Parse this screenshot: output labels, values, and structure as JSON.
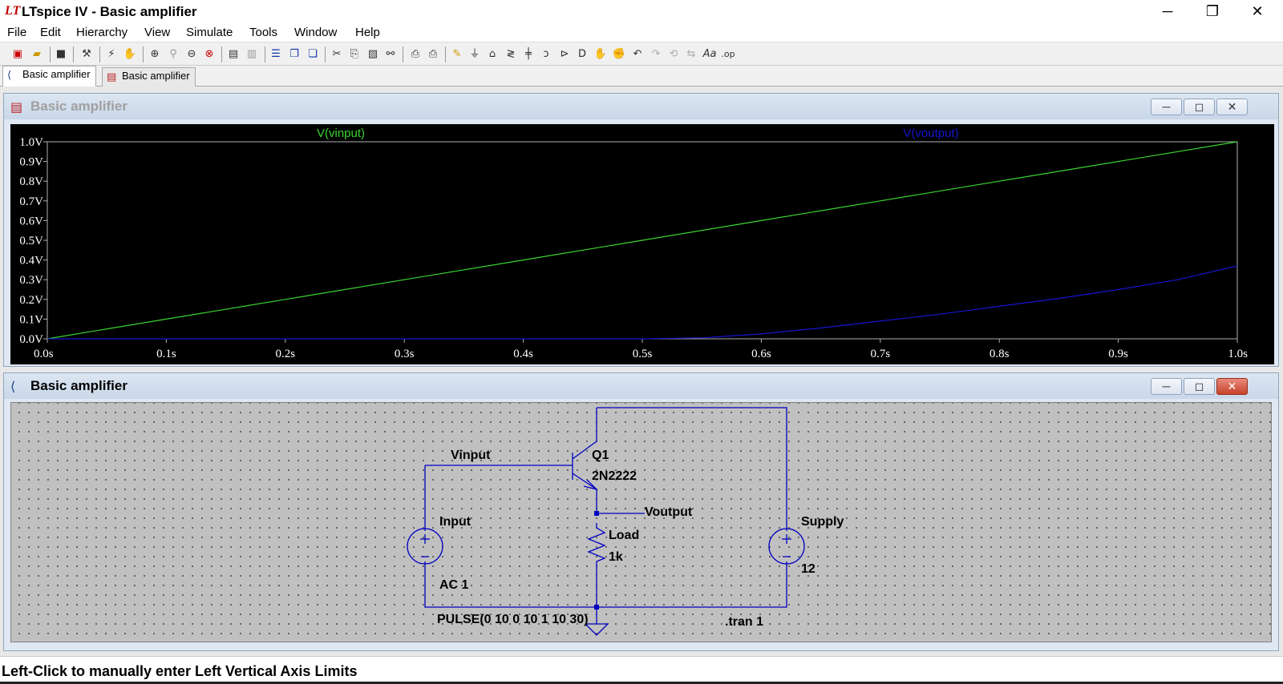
{
  "window": {
    "logo": "LT",
    "title": "LTspice IV - Basic amplifier",
    "minimize_glyph": "─",
    "maximize_glyph": "❐",
    "close_glyph": "✕"
  },
  "menu": [
    "File",
    "Edit",
    "Hierarchy",
    "View",
    "Simulate",
    "Tools",
    "Window",
    "Help"
  ],
  "toolbar": {
    "icons": [
      "new-schematic-icon",
      "open-icon",
      "save-icon",
      "control-panel-icon",
      "run-icon",
      "halt-icon",
      "zoom-in-icon",
      "zoom-out-area-icon",
      "zoom-out-icon",
      "zoom-fit-icon",
      "autorange-icon",
      "view-icon",
      "tile-horizontal-icon",
      "cascade-icon",
      "tile-vertical-icon",
      "cut-icon",
      "copy-icon",
      "paste-icon",
      "find-icon",
      "print-preview-icon",
      "print-icon",
      "wire-icon",
      "ground-icon",
      "label-icon",
      "resistor-icon",
      "capacitor-icon",
      "inductor-icon",
      "diode-icon",
      "component-icon",
      "move-icon",
      "drag-icon",
      "undo-icon",
      "redo-icon",
      "rotate-icon",
      "mirror-icon",
      "text-icon",
      "spice-directive-icon"
    ]
  },
  "tabs": [
    {
      "label": "Basic amplifier",
      "icon": "schematic-icon",
      "active": true
    },
    {
      "label": "Basic amplifier",
      "icon": "waveform-icon",
      "active": false
    }
  ],
  "waveform_window": {
    "title": "Basic amplifier",
    "buttons": {
      "minimize": "─",
      "maximize": "◻",
      "close": "✕"
    }
  },
  "schematic_window": {
    "title": "Basic amplifier",
    "buttons": {
      "minimize": "─",
      "maximize": "◻",
      "close": "✕"
    }
  },
  "chart_data": {
    "type": "line",
    "background": "#000000",
    "series": [
      {
        "name": "V(vinput)",
        "color": "#39d42f",
        "x": [
          0,
          0.1,
          0.2,
          0.3,
          0.4,
          0.5,
          0.6,
          0.7,
          0.8,
          0.9,
          1.0
        ],
        "y": [
          0,
          0.1,
          0.2,
          0.3,
          0.4,
          0.5,
          0.6,
          0.7,
          0.8,
          0.9,
          1.0
        ]
      },
      {
        "name": "V(voutput)",
        "color": "#1515d0",
        "x": [
          0,
          0.1,
          0.2,
          0.3,
          0.4,
          0.5,
          0.55,
          0.6,
          0.65,
          0.7,
          0.75,
          0.8,
          0.85,
          0.9,
          0.95,
          1.0
        ],
        "y": [
          0,
          0,
          0,
          0,
          0,
          0,
          0.005,
          0.025,
          0.055,
          0.09,
          0.125,
          0.165,
          0.205,
          0.25,
          0.3,
          0.37
        ]
      }
    ],
    "x_ticks": [
      "0.0s",
      "0.1s",
      "0.2s",
      "0.3s",
      "0.4s",
      "0.5s",
      "0.6s",
      "0.7s",
      "0.8s",
      "0.9s",
      "1.0s"
    ],
    "y_ticks": [
      "0.0V",
      "0.1V",
      "0.2V",
      "0.3V",
      "0.4V",
      "0.5V",
      "0.6V",
      "0.7V",
      "0.8V",
      "0.9V",
      "1.0V"
    ],
    "xlim": [
      0,
      1.0
    ],
    "ylim": [
      0,
      1.0
    ],
    "grid": false
  },
  "schematic": {
    "net_vinput": "Vinput",
    "net_voutput": "Voutput",
    "q1_name": "Q1",
    "q1_model": "2N2222",
    "load_name": "Load",
    "load_value": "1k",
    "input_name": "Input",
    "input_ac": "AC 1",
    "input_pulse": "PULSE(0 10 0 10 1 10 30)",
    "supply_name": "Supply",
    "supply_value": "12",
    "directive": ".tran 1",
    "wire_color": "#0000c0"
  },
  "status": "Left-Click to manually enter Left Vertical Axis Limits"
}
